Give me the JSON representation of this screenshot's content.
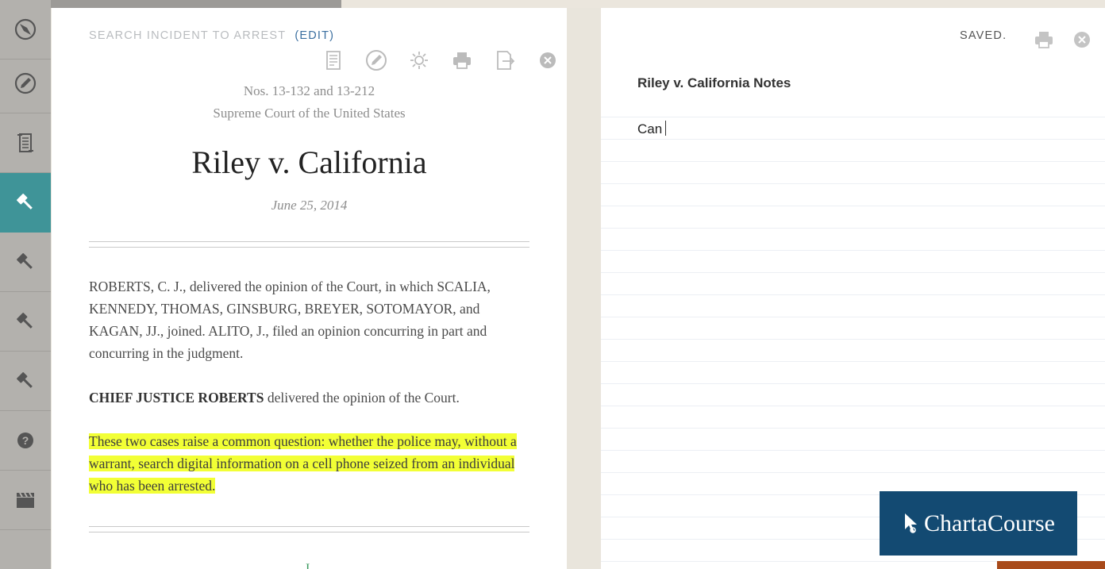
{
  "sidebar": {
    "items": [
      {
        "icon": "compass-icon"
      },
      {
        "icon": "pencil-icon"
      },
      {
        "icon": "scroll-icon"
      },
      {
        "icon": "gavel-icon",
        "active": true
      },
      {
        "icon": "gavel-icon"
      },
      {
        "icon": "gavel-icon"
      },
      {
        "icon": "gavel-icon"
      },
      {
        "icon": "help-icon"
      },
      {
        "icon": "clapperboard-icon"
      }
    ]
  },
  "document": {
    "breadcrumb": "SEARCH INCIDENT TO ARREST",
    "edit_label": "(EDIT)",
    "toolbar": [
      "outline-icon",
      "highlight-icon",
      "brightness-icon",
      "print-icon",
      "export-icon",
      "close-icon"
    ],
    "case_numbers": "Nos. 13-132 and 13-212",
    "court": "Supreme Court of the United States",
    "title": "Riley v. California",
    "date": "June 25, 2014",
    "syllabus": "ROBERTS, C. J., delivered the opinion of the Court, in which SCALIA, KENNEDY, THOMAS, GINSBURG, BREYER, SOTOMAYOR, and KAGAN, JJ., joined. ALITO, J., filed an opinion concurring in part and concurring in the judgment.",
    "opinion_author": "CHIEF JUSTICE ROBERTS",
    "opinion_rest": " delivered the opinion of the Court.",
    "highlighted_passage": "These two cases raise a common question: whether the police may, without a warrant, search digital information on a cell phone seized from an individual who has been arrested.",
    "section_marker": "I"
  },
  "notes": {
    "status": "SAVED.",
    "title": "Riley v. California Notes",
    "body": "Can"
  },
  "watermark": {
    "brand": "ChartaCourse"
  },
  "colors": {
    "sidebar_active": "#3f9498",
    "highlight": "#f2ff35",
    "edit_link": "#3b6fa0",
    "brand_bg": "#134a72"
  }
}
